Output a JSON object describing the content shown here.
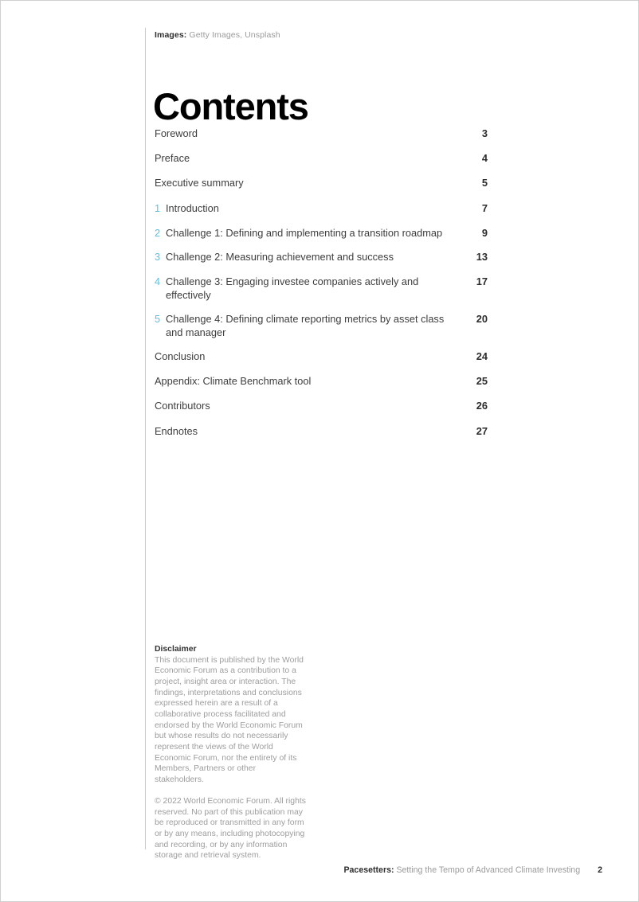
{
  "credit": {
    "label": "Images:",
    "sources": "Getty Images, Unsplash"
  },
  "title": "Contents",
  "toc": {
    "entries": [
      {
        "num": "",
        "label": "Foreword",
        "page": "3"
      },
      {
        "num": "",
        "label": "Preface",
        "page": "4"
      },
      {
        "num": "",
        "label": "Executive summary",
        "page": "5"
      },
      {
        "num": "1",
        "label": "Introduction",
        "page": "7"
      },
      {
        "num": "2",
        "label": "Challenge 1: Defining and implementing a transition roadmap",
        "page": "9"
      },
      {
        "num": "3",
        "label": "Challenge 2: Measuring achievement and success",
        "page": "13"
      },
      {
        "num": "4",
        "label": "Challenge 3: Engaging investee companies actively and effectively",
        "page": "17"
      },
      {
        "num": "5",
        "label": "Challenge 4: Defining climate reporting metrics by asset class and manager",
        "page": "20"
      },
      {
        "num": "",
        "label": "Conclusion",
        "page": "24"
      },
      {
        "num": "",
        "label": "Appendix: Climate Benchmark tool",
        "page": "25"
      },
      {
        "num": "",
        "label": "Contributors",
        "page": "26"
      },
      {
        "num": "",
        "label": "Endnotes",
        "page": "27"
      }
    ]
  },
  "disclaimer": {
    "heading": "Disclaimer",
    "body": "This document is published by the World Economic Forum as a contribution to a project, insight area or interaction. The findings, interpretations and conclusions expressed herein are a result of a collaborative process facilitated and endorsed by the World Economic Forum but whose results do not necessarily represent the views of the World Economic Forum, nor the entirety of its Members, Partners or other stakeholders.",
    "copyright": "© 2022 World Economic Forum. All rights reserved. No part of this publication may be reproduced or transmitted in any form or by any means, including photocopying and recording, or by any information storage and retrieval system."
  },
  "footer": {
    "brand": "Pacesetters:",
    "subtitle": "Setting the Tempo of Advanced Climate Investing",
    "page_number": "2"
  },
  "colors": {
    "accent_blue": "#5cbfe0",
    "body_text": "#3d3d3d",
    "muted_text": "#9d9d9d",
    "rule": "#c9c9c9"
  }
}
